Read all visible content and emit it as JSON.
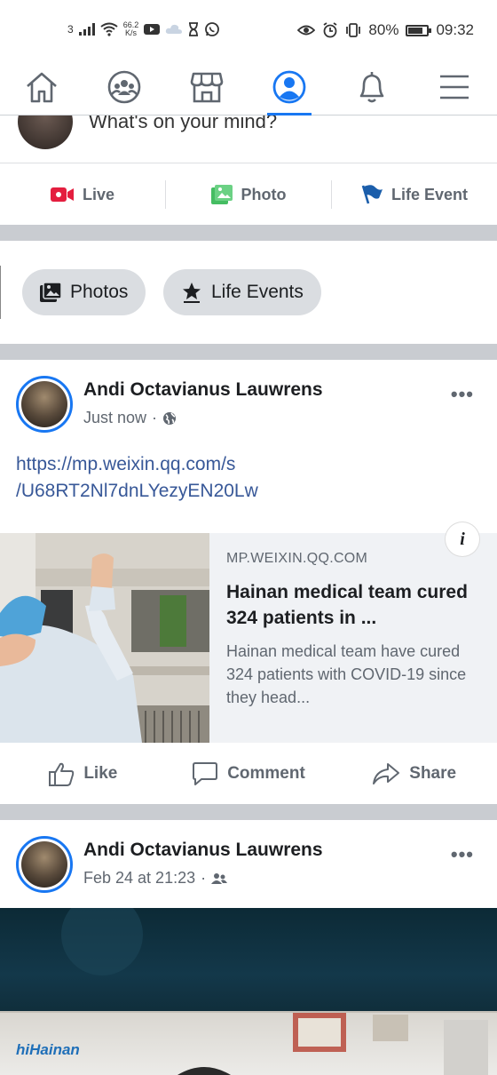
{
  "status_bar": {
    "sim_slot": "3",
    "net_speed_value": "66.2",
    "net_speed_unit": "K/s",
    "battery": "80%",
    "battery_level": 0.8,
    "time": "09:32"
  },
  "nav": {
    "items": [
      {
        "icon": "home-icon",
        "active": false
      },
      {
        "icon": "groups-icon",
        "active": false
      },
      {
        "icon": "marketplace-icon",
        "active": false
      },
      {
        "icon": "profile-icon",
        "active": true
      },
      {
        "icon": "bell-icon",
        "active": false
      },
      {
        "icon": "menu-icon",
        "active": false
      }
    ],
    "accent": "#1877f2"
  },
  "composer": {
    "placeholder": "What's on your mind?",
    "actions": {
      "live": "Live",
      "photo": "Photo",
      "life_event": "Life Event"
    }
  },
  "chips": {
    "photos": "Photos",
    "life_events": "Life Events"
  },
  "posts": [
    {
      "author": "Andi Octavianus Lauwrens",
      "time": "Just now",
      "audience_icon": "globe-icon",
      "link_text_line1": "https://mp.weixin.qq.com/s",
      "link_text_line2": "/U68RT2Nl7dnLYezyEN20Lw",
      "link_card": {
        "domain": "MP.WEIXIN.QQ.COM",
        "title": "Hainan medical team cured 324 patients in ...",
        "description": "Hainan medical team have cured 324 patients with COVID-19 since they head..."
      },
      "actions": {
        "like": "Like",
        "comment": "Comment",
        "share": "Share"
      }
    },
    {
      "author": "Andi Octavianus Lauwrens",
      "time": "Feb 24 at 21:23",
      "audience_icon": "friends-icon",
      "video_logo_prefix": "hi",
      "video_logo_text": "Hainan"
    }
  ],
  "colors": {
    "link": "#385898",
    "separator": "#c9ccd1",
    "live_red": "#e41e3f",
    "photo_green": "#45bd62",
    "flag_blue": "#1b5eab"
  }
}
